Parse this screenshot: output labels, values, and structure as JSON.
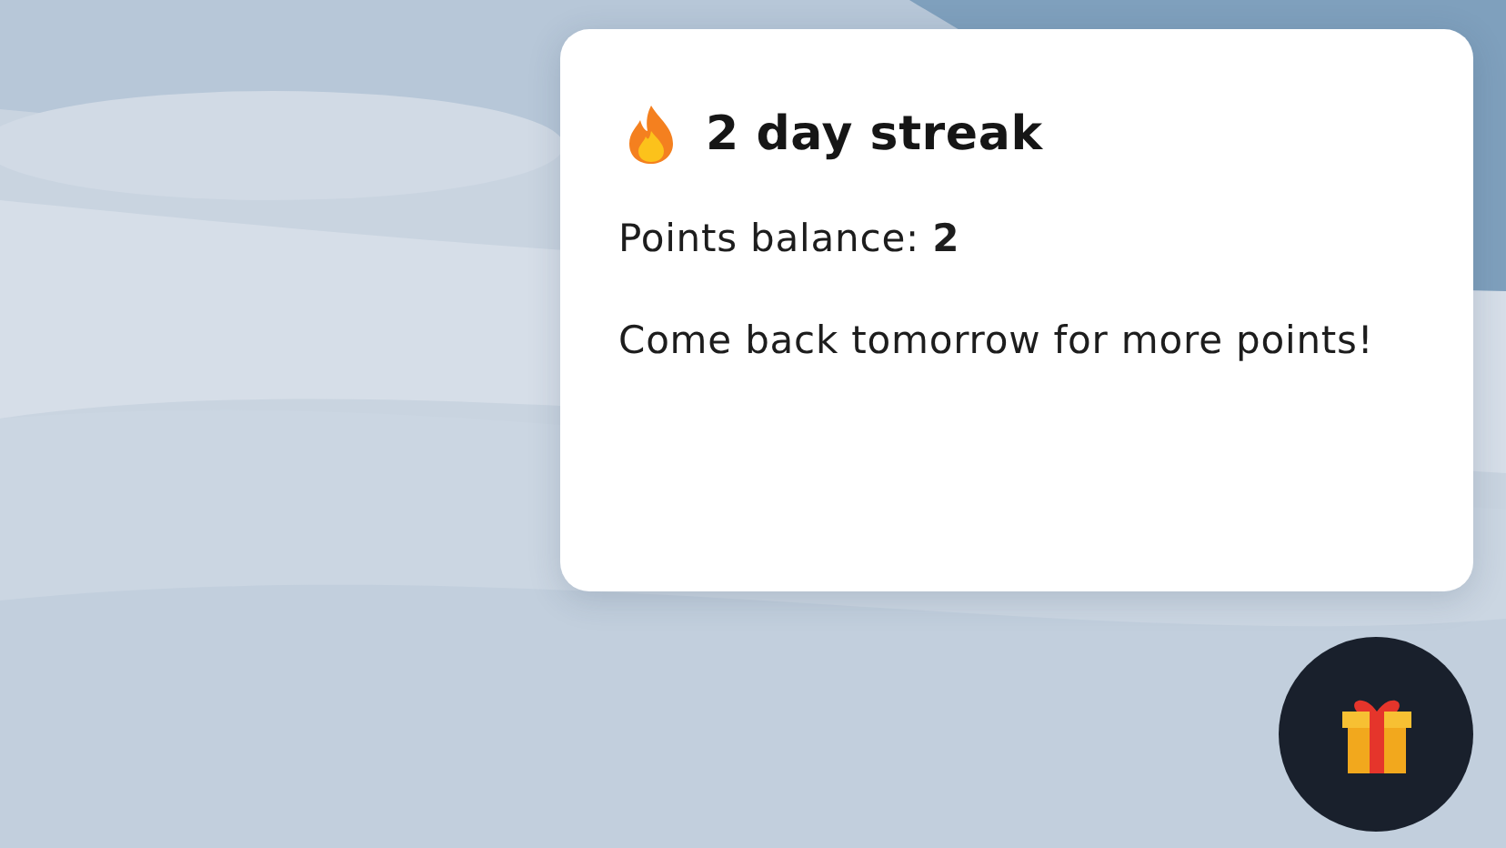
{
  "popup": {
    "title": "2 day streak",
    "balance": "Points balance: **2**",
    "message": "Come back tomorrow for more points!"
  },
  "launcher": {
    "kind": "gift"
  }
}
